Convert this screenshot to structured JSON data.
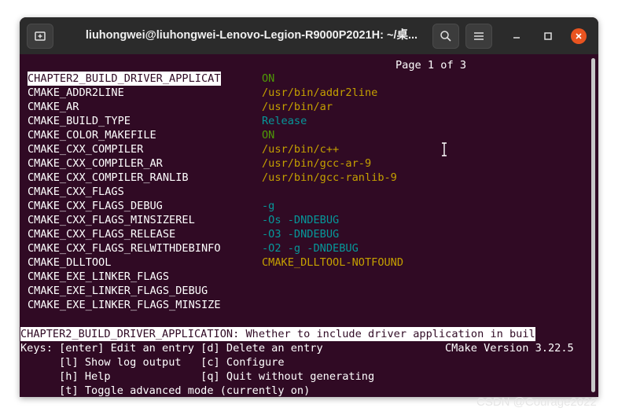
{
  "window": {
    "title": "liuhongwei@liuhongwei-Lenovo-Legion-R9000P2021H: ~/桌..."
  },
  "icons": {
    "new_tab": "new-tab-icon",
    "search": "search-icon",
    "menu": "hamburger-menu-icon",
    "minimize": "minimize-icon",
    "maximize": "maximize-icon",
    "close": "close-icon"
  },
  "colors": {
    "terminal_bg": "#300a24",
    "value_on": "#4e9a06",
    "value_path": "#c4a000",
    "value_cyan": "#06989a",
    "close_button": "#e95420"
  },
  "ccmake": {
    "page_indicator": "Page 1 of 3",
    "entries": [
      {
        "key": "CHAPTER2_BUILD_DRIVER_APPLICAT",
        "value": "ON",
        "color": "on",
        "selected": true
      },
      {
        "key": "CMAKE_ADDR2LINE",
        "value": "/usr/bin/addr2line",
        "color": "path"
      },
      {
        "key": "CMAKE_AR",
        "value": "/usr/bin/ar",
        "color": "path"
      },
      {
        "key": "CMAKE_BUILD_TYPE",
        "value": "Release",
        "color": "cyan"
      },
      {
        "key": "CMAKE_COLOR_MAKEFILE",
        "value": "ON",
        "color": "on"
      },
      {
        "key": "CMAKE_CXX_COMPILER",
        "value": "/usr/bin/c++",
        "color": "path"
      },
      {
        "key": "CMAKE_CXX_COMPILER_AR",
        "value": "/usr/bin/gcc-ar-9",
        "color": "path"
      },
      {
        "key": "CMAKE_CXX_COMPILER_RANLIB",
        "value": "/usr/bin/gcc-ranlib-9",
        "color": "path"
      },
      {
        "key": "CMAKE_CXX_FLAGS",
        "value": "",
        "color": "cyan"
      },
      {
        "key": "CMAKE_CXX_FLAGS_DEBUG",
        "value": "-g",
        "color": "cyan"
      },
      {
        "key": "CMAKE_CXX_FLAGS_MINSIZEREL",
        "value": "-Os -DNDEBUG",
        "color": "cyan"
      },
      {
        "key": "CMAKE_CXX_FLAGS_RELEASE",
        "value": "-O3 -DNDEBUG",
        "color": "cyan"
      },
      {
        "key": "CMAKE_CXX_FLAGS_RELWITHDEBINFO",
        "value": "-O2 -g -DNDEBUG",
        "color": "cyan"
      },
      {
        "key": "CMAKE_DLLTOOL",
        "value": "CMAKE_DLLTOOL-NOTFOUND",
        "color": "path"
      },
      {
        "key": "CMAKE_EXE_LINKER_FLAGS",
        "value": "",
        "color": "cyan"
      },
      {
        "key": "CMAKE_EXE_LINKER_FLAGS_DEBUG",
        "value": "",
        "color": "cyan"
      },
      {
        "key": "CMAKE_EXE_LINKER_FLAGS_MINSIZE",
        "value": "",
        "color": "cyan"
      }
    ],
    "status_line": "CHAPTER2_BUILD_DRIVER_APPLICATION: Whether to include driver application in buil",
    "keys_line1": "Keys: [enter] Edit an entry [d] Delete an entry",
    "cmake_version": "CMake Version 3.22.5",
    "keys_line2": "      [l] Show log output   [c] Configure",
    "keys_line3": "      [h] Help              [q] Quit without generating",
    "keys_line4": "      [t] Toggle advanced mode (currently on)"
  },
  "watermark": "CSDN @Courage2022"
}
